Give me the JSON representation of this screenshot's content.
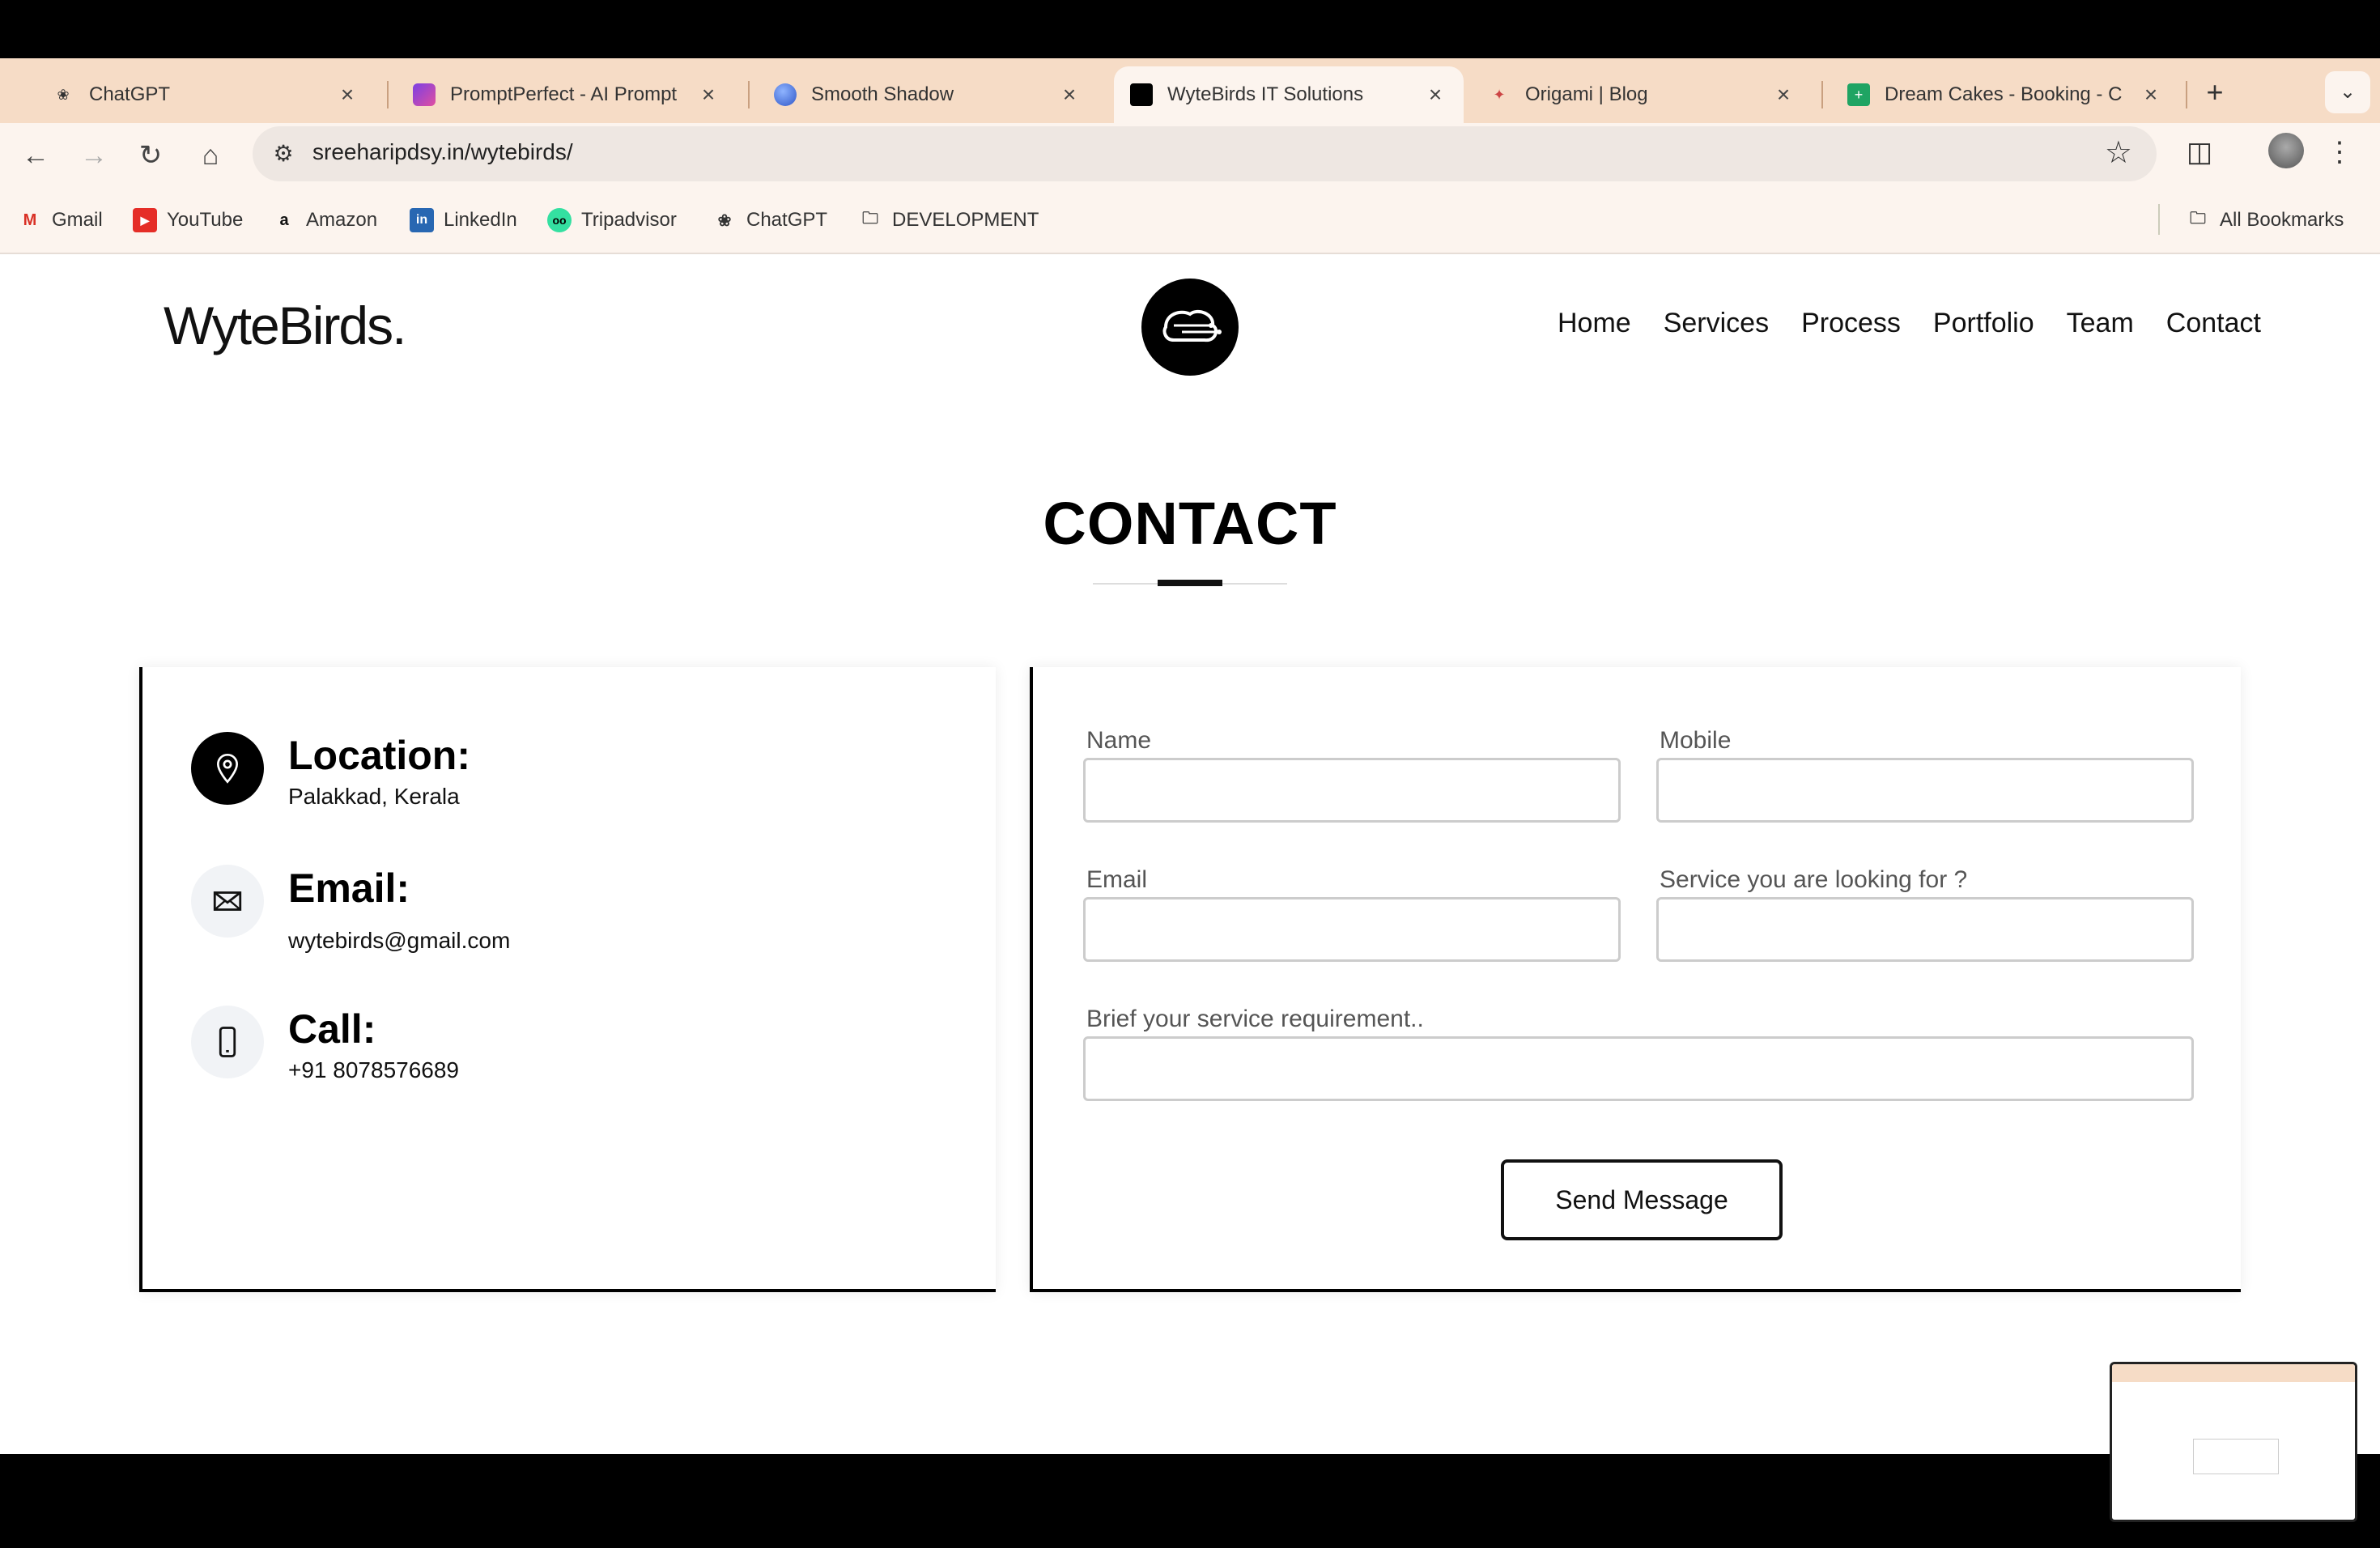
{
  "browser": {
    "tabs": [
      {
        "title": "ChatGPT",
        "favicon": "chatgpt-icon",
        "active": false
      },
      {
        "title": "PromptPerfect - AI Prompt",
        "favicon": "promptperfect-icon",
        "active": false
      },
      {
        "title": "Smooth Shadow",
        "favicon": "smooth-shadow-icon",
        "active": false
      },
      {
        "title": "WyteBirds IT Solutions",
        "favicon": "wytebirds-icon",
        "active": true
      },
      {
        "title": "Origami | Blog",
        "favicon": "origami-icon",
        "active": false
      },
      {
        "title": "Dream Cakes - Booking - C",
        "favicon": "sheets-icon",
        "active": false
      }
    ],
    "url": "sreeharipdsy.in/wytebirds/",
    "bookmarks": [
      {
        "label": "Gmail",
        "icon": "gmail-icon"
      },
      {
        "label": "YouTube",
        "icon": "youtube-icon"
      },
      {
        "label": "Amazon",
        "icon": "amazon-icon"
      },
      {
        "label": "LinkedIn",
        "icon": "linkedin-icon"
      },
      {
        "label": "Tripadvisor",
        "icon": "tripadvisor-icon"
      },
      {
        "label": "ChatGPT",
        "icon": "chatgpt-icon"
      },
      {
        "label": "DEVELOPMENT",
        "icon": "folder-icon"
      }
    ],
    "all_bookmarks": "All Bookmarks"
  },
  "site": {
    "brand": "WyteBirds.",
    "nav": [
      "Home",
      "Services",
      "Process",
      "Portfolio",
      "Team",
      "Contact"
    ],
    "section_title": "CONTACT",
    "contact_info": [
      {
        "heading": "Location:",
        "value": "Palakkad, Kerala",
        "icon": "location-pin-icon"
      },
      {
        "heading": "Email:",
        "value": "wytebirds@gmail.com",
        "icon": "envelope-icon"
      },
      {
        "heading": "Call:",
        "value": "+91 8078576689",
        "icon": "phone-icon"
      }
    ],
    "form": {
      "name_label": "Name",
      "mobile_label": "Mobile",
      "email_label": "Email",
      "service_label": "Service you are looking for ?",
      "brief_label": "Brief your service requirement..",
      "name_value": "",
      "mobile_value": "",
      "email_value": "",
      "service_value": "",
      "brief_value": "",
      "submit_label": "Send Message"
    }
  },
  "colors": {
    "tabstrip": "#f6dcc6",
    "toolbar": "#fcf4ee",
    "accent": "#000000"
  }
}
